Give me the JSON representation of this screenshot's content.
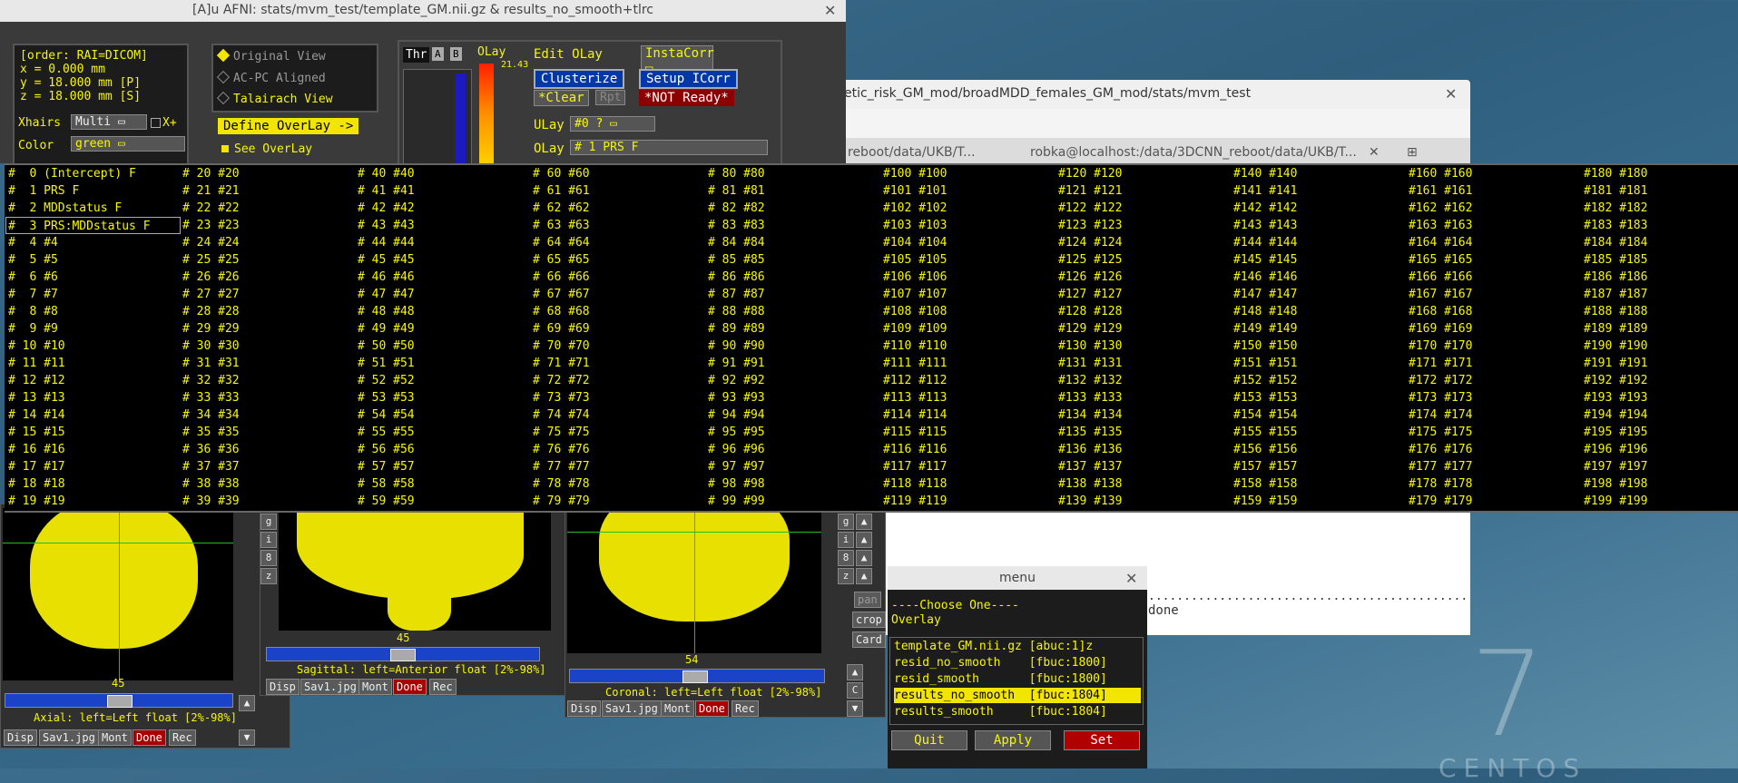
{
  "afni_window": {
    "title": "[A]u AFNI: stats/mvm_test/template_GM.nii.gz & results_no_smooth+tlrc",
    "coords": [
      "[order: RAI=DICOM]",
      "x =    0.000 mm",
      "y =   18.000 mm [P]",
      "z =   18.000 mm [S]"
    ],
    "xhairs_label": "Xhairs",
    "xhairs_value": "Multi",
    "xplus_label": "X+",
    "color_label": "Color",
    "color_value": "green",
    "views": [
      "Original View",
      "AC-PC Aligned",
      "Talairach View"
    ],
    "define_overlay": "Define OverLay ->",
    "see_overlay": "See OverLay",
    "thr_label": "Thr",
    "a_label": "A",
    "b_label": "B",
    "olay_label": "OLay",
    "olay_max": "21.43",
    "edit_olay": "Edit OLay",
    "instacorr": "InstaCorr",
    "clusterize": "Clusterize",
    "setup_icorr": "Setup ICorr",
    "clear": "*Clear",
    "rpt": "Rpt",
    "not_ready": "*NOT Ready*",
    "ulay_label": "ULay",
    "ulay_value": "#0 ?",
    "olay_value_label": "OLay",
    "olay_value": "#  1 PRS F"
  },
  "terminal": {
    "title": "etic_risk_GM_mod/broadMDD_females_GM_mod/stats/mvm_test",
    "tab1": "reboot/data/UKB/T...",
    "tab2": "robka@localhost:/data/3DCNN_reboot/data/UKB/T...",
    "dots": ".............................................",
    "done": "done"
  },
  "overlay_list": {
    "col1": [
      "#  0 (Intercept) F",
      "#  1 PRS F",
      "#  2 MDDstatus F",
      "#  3 PRS:MDDstatus F",
      "#  4 #4",
      "#  5 #5",
      "#  6 #6",
      "#  7 #7",
      "#  8 #8",
      "#  9 #9",
      "# 10 #10",
      "# 11 #11",
      "# 12 #12",
      "# 13 #13",
      "# 14 #14",
      "# 15 #15",
      "# 16 #16",
      "# 17 #17",
      "# 18 #18",
      "# 19 #19"
    ],
    "col2": [
      "# 20 #20",
      "# 21 #21",
      "# 22 #22",
      "# 23 #23",
      "# 24 #24",
      "# 25 #25",
      "# 26 #26",
      "# 27 #27",
      "# 28 #28",
      "# 29 #29",
      "# 30 #30",
      "# 31 #31",
      "# 32 #32",
      "# 33 #33",
      "# 34 #34",
      "# 35 #35",
      "# 36 #36",
      "# 37 #37",
      "# 38 #38",
      "# 39 #39"
    ],
    "col3": [
      "# 40 #40",
      "# 41 #41",
      "# 42 #42",
      "# 43 #43",
      "# 44 #44",
      "# 45 #45",
      "# 46 #46",
      "# 47 #47",
      "# 48 #48",
      "# 49 #49",
      "# 50 #50",
      "# 51 #51",
      "# 52 #52",
      "# 53 #53",
      "# 54 #54",
      "# 55 #55",
      "# 56 #56",
      "# 57 #57",
      "# 58 #58",
      "# 59 #59"
    ],
    "col4": [
      "# 60 #60",
      "# 61 #61",
      "# 62 #62",
      "# 63 #63",
      "# 64 #64",
      "# 65 #65",
      "# 66 #66",
      "# 67 #67",
      "# 68 #68",
      "# 69 #69",
      "# 70 #70",
      "# 71 #71",
      "# 72 #72",
      "# 73 #73",
      "# 74 #74",
      "# 75 #75",
      "# 76 #76",
      "# 77 #77",
      "# 78 #78",
      "# 79 #79"
    ],
    "col5": [
      "# 80 #80",
      "# 81 #81",
      "# 82 #82",
      "# 83 #83",
      "# 84 #84",
      "# 85 #85",
      "# 86 #86",
      "# 87 #87",
      "# 88 #88",
      "# 89 #89",
      "# 90 #90",
      "# 91 #91",
      "# 92 #92",
      "# 93 #93",
      "# 94 #94",
      "# 95 #95",
      "# 96 #96",
      "# 97 #97",
      "# 98 #98",
      "# 99 #99"
    ],
    "col6": [
      "#100 #100",
      "#101 #101",
      "#102 #102",
      "#103 #103",
      "#104 #104",
      "#105 #105",
      "#106 #106",
      "#107 #107",
      "#108 #108",
      "#109 #109",
      "#110 #110",
      "#111 #111",
      "#112 #112",
      "#113 #113",
      "#114 #114",
      "#115 #115",
      "#116 #116",
      "#117 #117",
      "#118 #118",
      "#119 #119"
    ],
    "col7": [
      "#120 #120",
      "#121 #121",
      "#122 #122",
      "#123 #123",
      "#124 #124",
      "#125 #125",
      "#126 #126",
      "#127 #127",
      "#128 #128",
      "#129 #129",
      "#130 #130",
      "#131 #131",
      "#132 #132",
      "#133 #133",
      "#134 #134",
      "#135 #135",
      "#136 #136",
      "#137 #137",
      "#138 #138",
      "#139 #139"
    ],
    "col8": [
      "#140 #140",
      "#141 #141",
      "#142 #142",
      "#143 #143",
      "#144 #144",
      "#145 #145",
      "#146 #146",
      "#147 #147",
      "#148 #148",
      "#149 #149",
      "#150 #150",
      "#151 #151",
      "#152 #152",
      "#153 #153",
      "#154 #154",
      "#155 #155",
      "#156 #156",
      "#157 #157",
      "#158 #158",
      "#159 #159"
    ],
    "col9": [
      "#160 #160",
      "#161 #161",
      "#162 #162",
      "#163 #163",
      "#164 #164",
      "#165 #165",
      "#166 #166",
      "#167 #167",
      "#168 #168",
      "#169 #169",
      "#170 #170",
      "#171 #171",
      "#172 #172",
      "#173 #173",
      "#174 #174",
      "#175 #175",
      "#176 #176",
      "#177 #177",
      "#178 #178",
      "#179 #179"
    ],
    "col10": [
      "#180 #180",
      "#181 #181",
      "#182 #182",
      "#183 #183",
      "#184 #184",
      "#185 #185",
      "#186 #186",
      "#187 #187",
      "#188 #188",
      "#189 #189",
      "#190 #190",
      "#191 #191",
      "#192 #192",
      "#193 #193",
      "#194 #194",
      "#195 #195",
      "#196 #196",
      "#197 #197",
      "#198 #198",
      "#199 #199"
    ]
  },
  "axial": {
    "slice": "45",
    "label": "Axial: left=Left float [2%-98%]",
    "buttons": [
      "Disp",
      "Sav1.jpg",
      "Mont",
      "Done",
      "Rec"
    ]
  },
  "sagittal": {
    "slice": "45",
    "label": "Sagittal: left=Anterior float [2%-98%]",
    "buttons": [
      "Disp",
      "Sav1.jpg",
      "Mont",
      "Done",
      "Rec"
    ]
  },
  "coronal": {
    "slice": "54",
    "label": "Coronal: left=Left float [2%-98%]",
    "buttons": [
      "Disp",
      "Sav1.jpg",
      "Mont",
      "Done",
      "Rec"
    ],
    "side_labels": [
      "pan",
      "crop",
      "Card"
    ]
  },
  "menu_window": {
    "title": "menu",
    "heading1": "----Choose One----",
    "heading2": "Overlay",
    "items": [
      "template_GM.nii.gz [abuc:1]z",
      "resid_no_smooth    [fbuc:1800]",
      "resid_smooth       [fbuc:1800]",
      "results_no_smooth  [fbuc:1804]",
      "results_smooth     [fbuc:1804]"
    ],
    "quit": "Quit",
    "apply": "Apply",
    "set": "Set"
  },
  "desktop": {
    "logo_number": "7",
    "logo_word": "CENTOS"
  },
  "colors": {
    "list_text": "#f7f700",
    "selected_bg": "#f2e600",
    "crosshair": "#20c020"
  }
}
